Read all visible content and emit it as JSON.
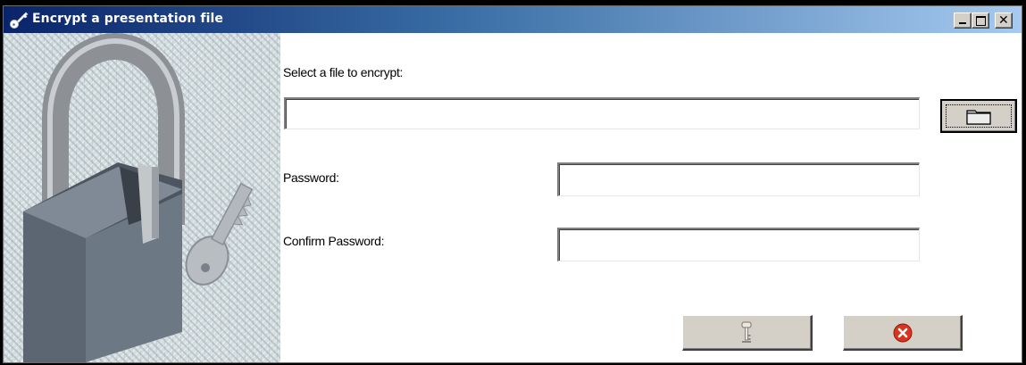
{
  "window": {
    "title": "Encrypt a presentation file",
    "title_icon": "key-icon",
    "controls": [
      "minimize-icon",
      "maximize-icon",
      "close-icon"
    ],
    "titlebar_color_start": "#0a246a",
    "titlebar_color_end": "#a6caf0"
  },
  "illustration": {
    "name": "padlock-and-key-illustration"
  },
  "form": {
    "file_label": "Select a file to encrypt:",
    "file_value": "",
    "password_label": "Password:",
    "password_value": "",
    "confirm_label": "Confirm Password:",
    "confirm_value": ""
  },
  "buttons": {
    "browse_icon": "folder-icon",
    "encrypt_icon": "key-icon",
    "cancel_icon": "cancel-icon",
    "cancel_color": "#d9341f"
  }
}
